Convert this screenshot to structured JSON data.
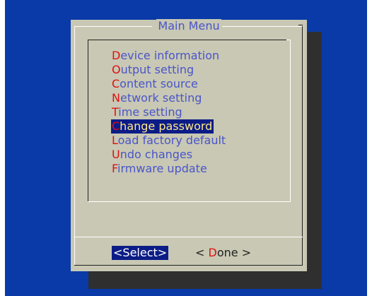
{
  "dialog": {
    "title": "Main Menu"
  },
  "menu": {
    "items": [
      {
        "hotkey": "D",
        "rest": "evice information"
      },
      {
        "hotkey": "O",
        "rest": "utput setting"
      },
      {
        "hotkey": "C",
        "rest": "ontent source"
      },
      {
        "hotkey": "N",
        "rest": "etwork setting"
      },
      {
        "hotkey": "T",
        "rest": "ime setting"
      },
      {
        "hotkey": "C",
        "rest": "hange password"
      },
      {
        "hotkey": "L",
        "rest": "oad factory default"
      },
      {
        "hotkey": "U",
        "rest": "ndo changes"
      },
      {
        "hotkey": "F",
        "rest": "irmware update"
      }
    ],
    "selected_index": 5
  },
  "buttons": {
    "select_label": "<Select>",
    "done_prefix": "< ",
    "done_hotkey": "D",
    "done_rest": "one >"
  },
  "colors": {
    "screen_bg": "#0a3aa8",
    "dialog_bg": "#c8c8b4",
    "item_text": "#4a55c8",
    "hotkey": "#e01010",
    "highlight_bg": "#0c1c86",
    "highlight_text": "#ffe88a"
  }
}
